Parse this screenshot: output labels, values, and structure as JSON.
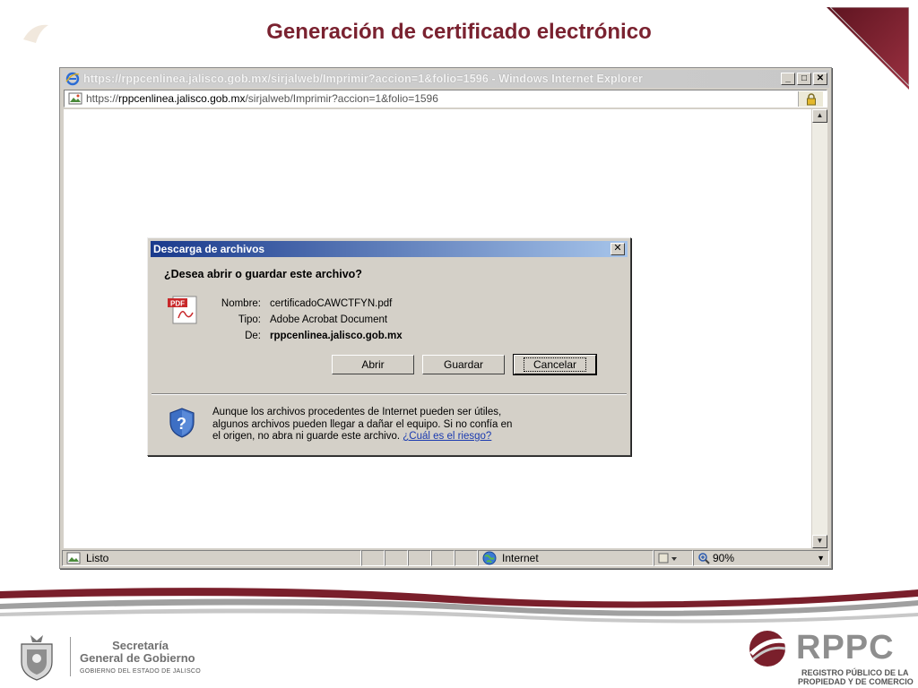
{
  "slide": {
    "title": "Generación de certificado electrónico"
  },
  "browser": {
    "window_title": "https://rppcenlinea.jalisco.gob.mx/sirjalweb/Imprimir?accion=1&folio=1596 - Windows Internet Explorer",
    "address_prefix": "https://",
    "address_host": "rppcenlinea.jalisco.gob.mx",
    "address_path": "/sirjalweb/Imprimir?accion=1&folio=1596",
    "window_buttons": {
      "minimize": "_",
      "maximize": "□",
      "close": "✕"
    },
    "status": {
      "text": "Listo",
      "zone": "Internet",
      "zoom": "90%"
    }
  },
  "dialog": {
    "title": "Descarga de archivos",
    "close": "✕",
    "question": "¿Desea abrir o guardar este archivo?",
    "file": {
      "name_label": "Nombre:",
      "name_value": "certificadoCAWCTFYN.pdf",
      "type_label": "Tipo:",
      "type_value": "Adobe Acrobat Document",
      "from_label": "De:",
      "from_value": "rppcenlinea.jalisco.gob.mx",
      "icon_text": "PDF"
    },
    "buttons": {
      "open": "Abrir",
      "save": "Guardar",
      "cancel": "Cancelar"
    },
    "warning": {
      "line1": "Aunque los archivos procedentes de Internet pueden ser útiles,",
      "line2": "algunos archivos pueden llegar a dañar el equipo. Si no confía en",
      "line3_prefix": "el origen, no abra ni guarde este archivo. ",
      "link": "¿Cuál es el riesgo?"
    }
  },
  "footer": {
    "sgg_line1": "Secretaría",
    "sgg_line2": "General de Gobierno",
    "sgg_line3": "GOBIERNO DEL ESTADO DE JALISCO",
    "rppc": "RPPC",
    "rppc_sub1": "REGISTRO PÚBLICO DE LA",
    "rppc_sub2": "PROPIEDAD Y DE COMERCIO"
  },
  "colors": {
    "title": "#7a2230",
    "brand_maroon": "#7a1f2b",
    "dialog_titlebar": "#1a3a8c",
    "link": "#1a3ab0"
  }
}
